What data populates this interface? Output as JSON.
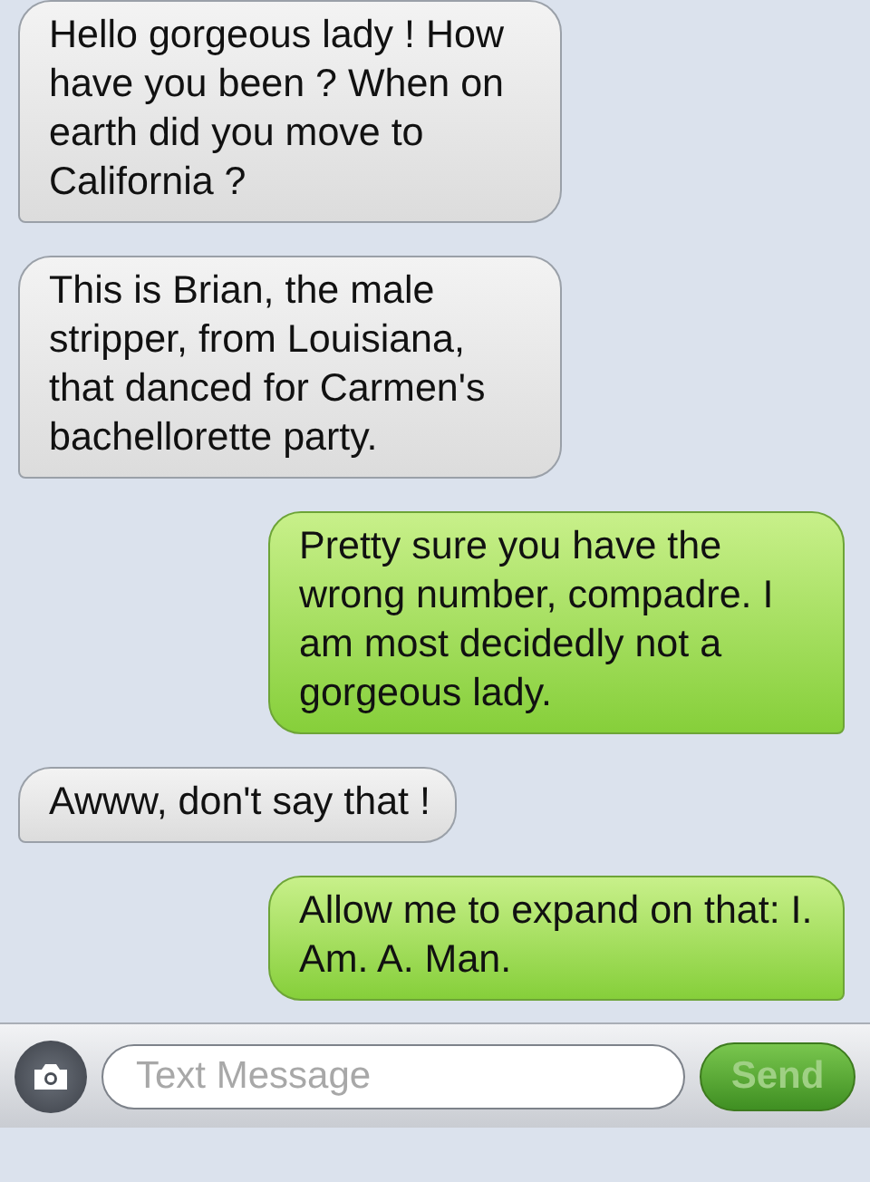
{
  "messages": [
    {
      "kind": "received",
      "text": "Hello gorgeous lady ! How have you been ? When on earth did you move to California ?"
    },
    {
      "kind": "received",
      "text": "This is Brian, the male stripper, from Louisiana, that danced for Carmen's bachellorette party."
    },
    {
      "kind": "sent",
      "text": "Pretty sure you have the wrong number, compadre. I am most decidedly not a gorgeous lady."
    },
    {
      "kind": "received",
      "text": "Awww, don't say that !"
    },
    {
      "kind": "sent",
      "text": "Allow me to expand on that: I. Am. A. Man."
    }
  ],
  "composer": {
    "placeholder": "Text Message",
    "send": {
      "label": "Send",
      "disabled": true
    }
  }
}
